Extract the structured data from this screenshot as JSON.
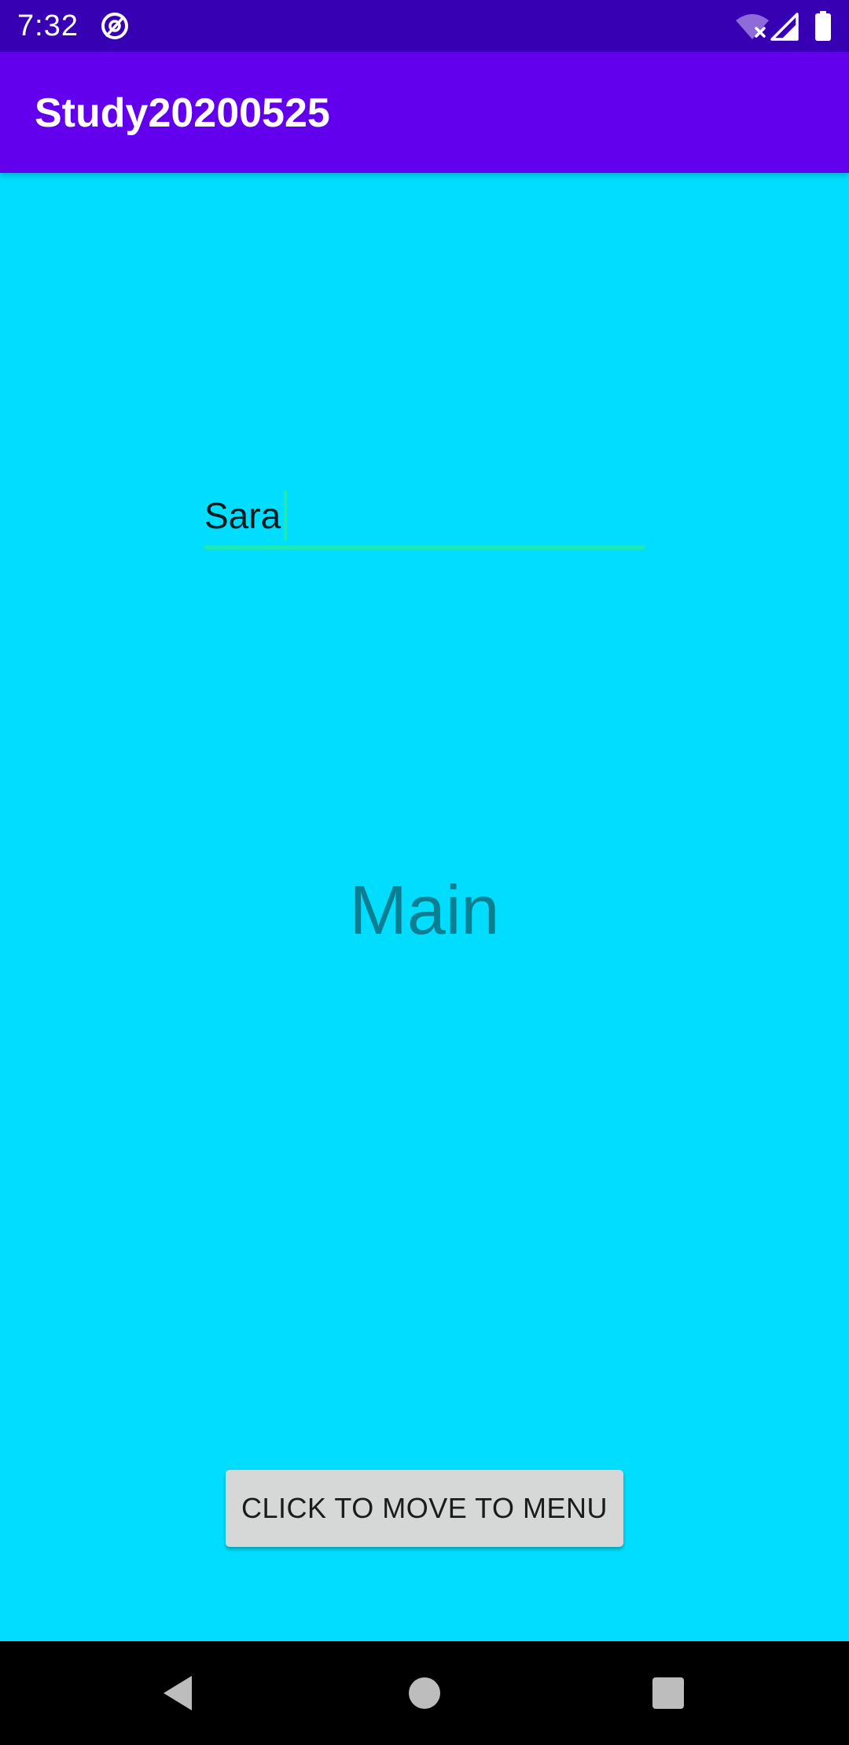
{
  "status_bar": {
    "time": "7:32",
    "icons": [
      "sync-icon",
      "wifi-off-icon",
      "signal-icon",
      "battery-icon"
    ],
    "background": "#3700B3"
  },
  "app_bar": {
    "title": "Study20200525",
    "background": "#6200EE"
  },
  "main": {
    "background": "#00DDFF",
    "name_input": {
      "value": "Sara",
      "accent": "#1DE9B6"
    },
    "label": "Main",
    "label_color": "#0B7F92",
    "button": {
      "label": "CLICK TO MOVE TO MENU"
    }
  },
  "nav_bar": {
    "icons": [
      "back-icon",
      "home-icon",
      "recents-icon"
    ]
  }
}
